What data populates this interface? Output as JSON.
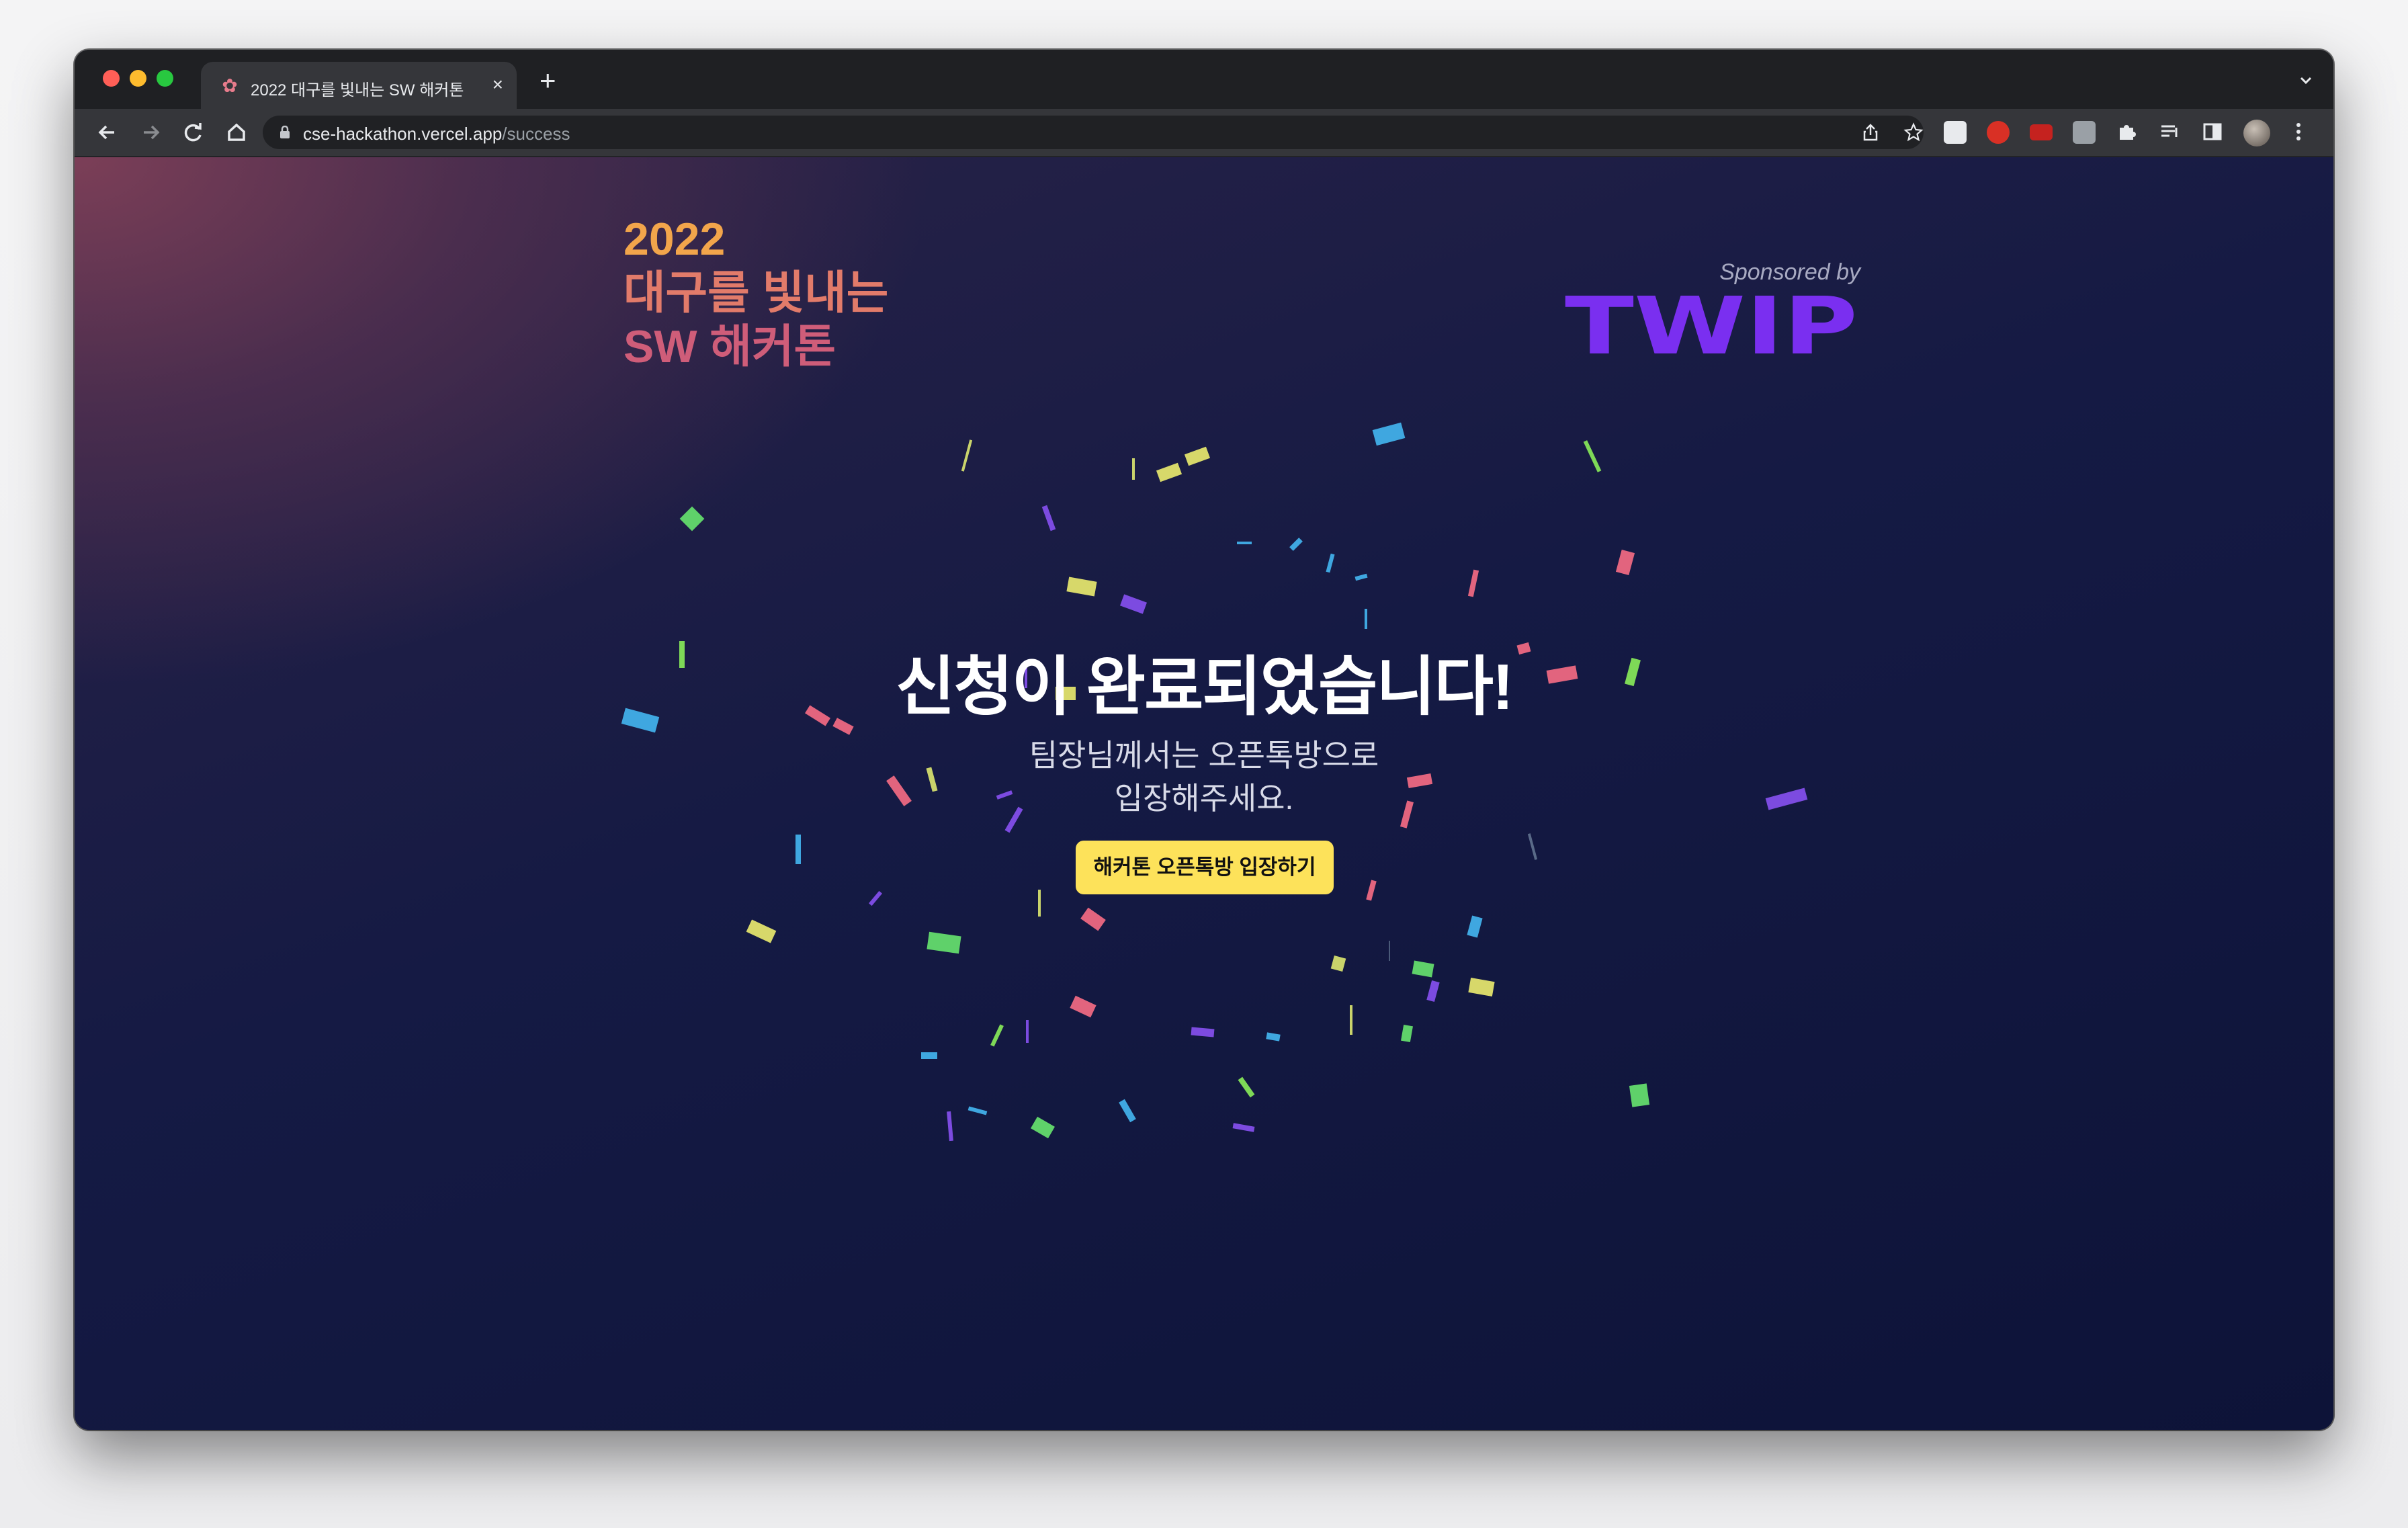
{
  "browser": {
    "tab_title": "2022 대구를 빛내는 SW 해커톤",
    "tab_close": "×",
    "new_tab": "+",
    "url_host": "cse-hackathon.vercel.app",
    "url_path": "/success"
  },
  "page": {
    "logo_lines": [
      "2022",
      "대구를 빛내는",
      "SW 해커톤"
    ],
    "sponsor_label": "Sponsored by",
    "sponsor_name": "TWIP",
    "headline": "신청이 완료되었습니다!",
    "subtext_lines": [
      "팀장님께서는 오픈톡방으로",
      "입장해주세요."
    ],
    "cta_label": "해커톤 오픈톡방 입장하기"
  },
  "colors": {
    "accent_yellow": "#fde25a",
    "twip_purple": "#7a2ff0",
    "logo_orange": "#f2a54b",
    "logo_pink": "#cf5d79"
  },
  "icons": [
    "back-icon",
    "forward-icon",
    "reload-icon",
    "home-icon",
    "lock-icon",
    "share-icon",
    "star-icon",
    "extension-icon",
    "reading-list-icon",
    "sidebar-icon",
    "profile-avatar",
    "more-icon"
  ]
}
